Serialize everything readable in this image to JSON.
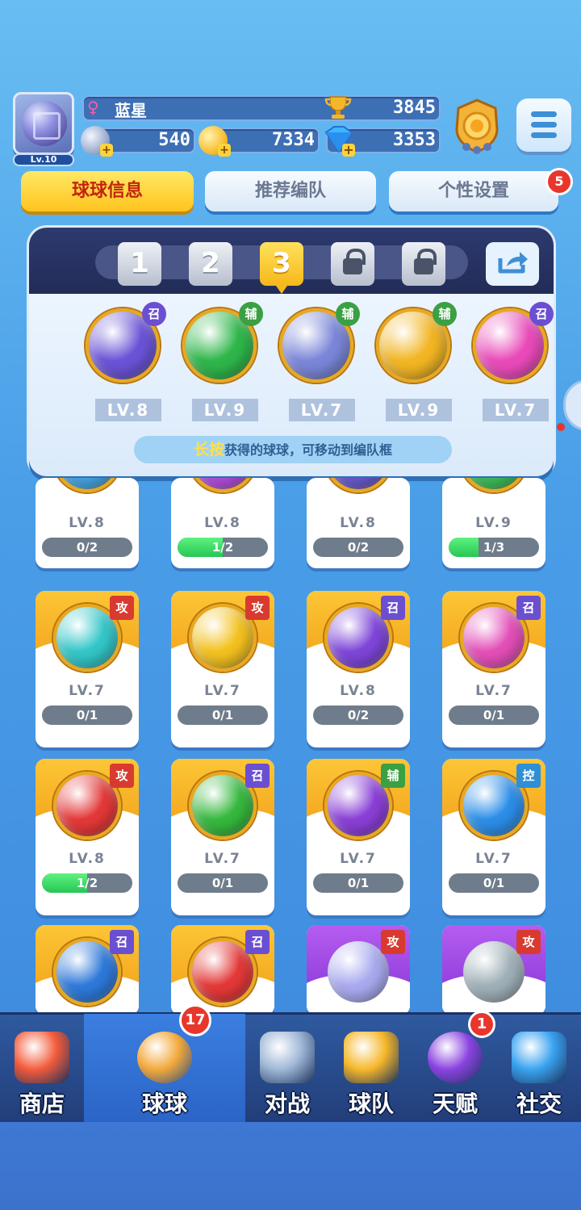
{
  "player": {
    "name": "蓝星",
    "gender_symbol": "♀",
    "level": "Lv.10",
    "trophies": "3845",
    "currency_silver": "540",
    "currency_gold": "7334",
    "currency_diamond": "3353"
  },
  "tabs": [
    {
      "label": "球球信息",
      "active": true
    },
    {
      "label": "推荐编队",
      "active": false
    },
    {
      "label": "个性设置",
      "active": false,
      "badge": "5"
    }
  ],
  "team": {
    "slots": [
      "1",
      "2",
      "3",
      "lock",
      "lock"
    ],
    "active_slot": "3",
    "balls": [
      {
        "level": "LV.8",
        "tag": "召",
        "color": "#6a53d6"
      },
      {
        "level": "LV.9",
        "tag": "辅",
        "color": "#2eb64a"
      },
      {
        "level": "LV.7",
        "tag": "辅",
        "color": "#7a86d8"
      },
      {
        "level": "LV.9",
        "tag": "辅",
        "color": "#f2b523"
      },
      {
        "level": "LV.7",
        "tag": "召",
        "color": "#e94ab9"
      }
    ],
    "hint_highlight": "长按",
    "hint_rest": "获得的球球，可移动到编队框"
  },
  "ball_rows": [
    [
      {
        "level": "LV.8",
        "progress": "0/2",
        "fill": 0,
        "color": "#48a7e6"
      },
      {
        "level": "LV.8",
        "progress": "1/2",
        "fill": 0.5,
        "color": "#b64ee0"
      },
      {
        "level": "LV.8",
        "progress": "0/2",
        "fill": 0,
        "color": "#6a5cd1"
      },
      {
        "level": "LV.9",
        "progress": "1/3",
        "fill": 0.33,
        "color": "#3fc05a"
      }
    ],
    [
      {
        "level": "LV.7",
        "progress": "0/1",
        "fill": 0,
        "tag": "攻",
        "color": "#33c6c8"
      },
      {
        "level": "LV.7",
        "progress": "0/1",
        "fill": 0,
        "tag": "攻",
        "color": "#f3c11f"
      },
      {
        "level": "LV.8",
        "progress": "0/2",
        "fill": 0,
        "tag": "召",
        "color": "#7e46d8"
      },
      {
        "level": "LV.7",
        "progress": "0/1",
        "fill": 0,
        "tag": "召",
        "color": "#e34fb8"
      }
    ],
    [
      {
        "level": "LV.8",
        "progress": "1/2",
        "fill": 0.5,
        "tag": "攻",
        "color": "#e43838"
      },
      {
        "level": "LV.7",
        "progress": "0/1",
        "fill": 0,
        "tag": "召",
        "color": "#36b83e"
      },
      {
        "level": "LV.7",
        "progress": "0/1",
        "fill": 0,
        "tag": "辅",
        "color": "#8a3fd6"
      },
      {
        "level": "LV.7",
        "progress": "0/1",
        "fill": 0,
        "tag": "控",
        "color": "#2c8ee8"
      }
    ],
    [
      {
        "tag": "召",
        "color": "#2e79d9",
        "card": "gold"
      },
      {
        "tag": "召",
        "color": "#e43838",
        "card": "gold"
      },
      {
        "tag": "攻",
        "color": "#a9a9f0",
        "card": "purple"
      },
      {
        "tag": "攻",
        "color": "#9fb0b8",
        "card": "purple"
      }
    ]
  ],
  "nav": [
    {
      "label": "商店",
      "icon": "shop-icon"
    },
    {
      "label": "球球",
      "icon": "balls-icon",
      "active": true,
      "badge": "17"
    },
    {
      "label": "对战",
      "icon": "crossed-swords-icon"
    },
    {
      "label": "球队",
      "icon": "whistle-icon"
    },
    {
      "label": "天赋",
      "icon": "planet-icon",
      "badge": "1"
    },
    {
      "label": "社交",
      "icon": "chat-heart-icon"
    }
  ],
  "colors": {
    "tag_attack": "#d93a2f",
    "tag_summon": "#6b4fd1",
    "tag_support": "#3ba043",
    "tag_control": "#2e8ed6",
    "accent_gold": "#ffc41d"
  }
}
